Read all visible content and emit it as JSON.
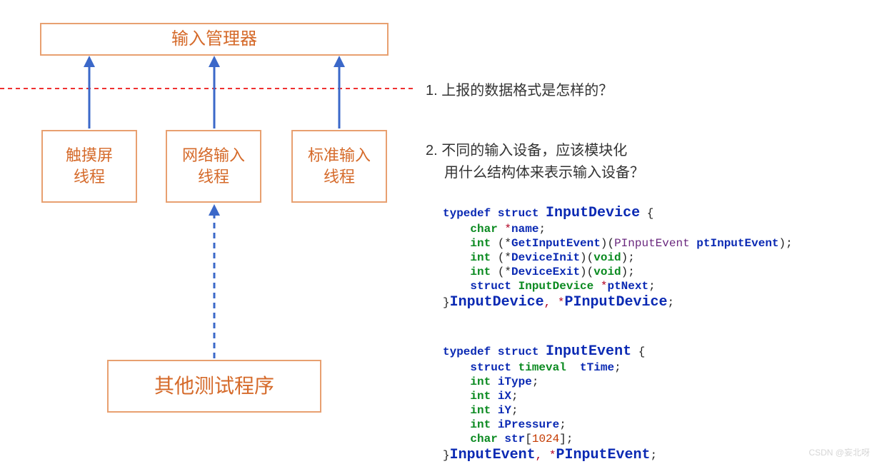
{
  "manager": "输入管理器",
  "threads": {
    "touch": "触摸屏\n线程",
    "net": "网络输入\n线程",
    "std": "标准输入\n线程"
  },
  "testprog": "其他测试程序",
  "q1": "1. 上报的数据格式是怎样的？",
  "q2a": "2. 不同的输入设备，应该模块化",
  "q2b": "用什么结构体来表示输入设备？",
  "code1": {
    "l1_a": "typedef",
    "l1_b": "struct",
    "l1_c": "InputDevice",
    "l1_d": "{",
    "l2_a": "char",
    "l2_b": "*",
    "l2_c": "name",
    "l2_d": ";",
    "l3_a": "int",
    "l3_b": "(*",
    "l3_c": "GetInputEvent",
    "l3_d": ")(",
    "l3_e": "PInputEvent",
    "l3_f": "ptInputEvent",
    "l3_g": ");",
    "l4_a": "int",
    "l4_b": "(*",
    "l4_c": "DeviceInit",
    "l4_d": ")(",
    "l4_e": "void",
    "l4_f": ");",
    "l5_a": "int",
    "l5_b": "(*",
    "l5_c": "DeviceExit",
    "l5_d": ")(",
    "l5_e": "void",
    "l5_f": ");",
    "l6_a": "struct",
    "l6_b": "InputDevice",
    "l6_c": "*",
    "l6_d": "ptNext",
    "l6_e": ";",
    "l7_a": "}",
    "l7_b": "InputDevice",
    "l7_c": ", *",
    "l7_d": "PInputDevice",
    "l7_e": ";"
  },
  "code2": {
    "l1_a": "typedef",
    "l1_b": "struct",
    "l1_c": "InputEvent",
    "l1_d": "{",
    "l2_a": "struct",
    "l2_b": "timeval",
    "l2_c": "tTime",
    "l2_d": ";",
    "l3_a": "int",
    "l3_b": "iType",
    "l3_c": ";",
    "l4_a": "int",
    "l4_b": "iX",
    "l4_c": ";",
    "l5_a": "int",
    "l5_b": "iY",
    "l5_c": ";",
    "l6_a": "int",
    "l6_b": "iPressure",
    "l6_c": ";",
    "l7_a": "char",
    "l7_b": "str",
    "l7_c": "[",
    "l7_d": "1024",
    "l7_e": "];",
    "l8_a": "}",
    "l8_b": "InputEvent",
    "l8_c": ", *",
    "l8_d": "PInputEvent",
    "l8_e": ";"
  },
  "watermark": "CSDN @妄北呀"
}
